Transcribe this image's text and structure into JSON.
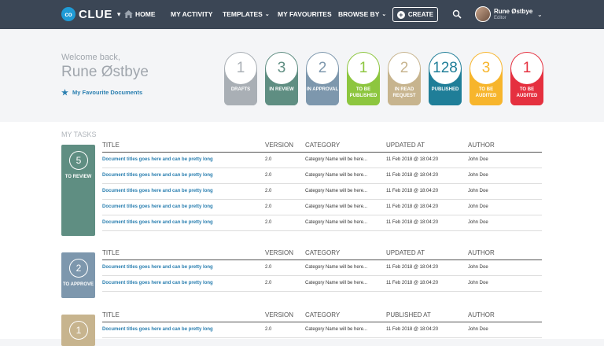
{
  "nav": {
    "logo_mark": "co",
    "logo_text": "CLUE",
    "items": [
      {
        "label": "HOME"
      },
      {
        "label": "MY ACTIVITY"
      },
      {
        "label": "TEMPLATES"
      },
      {
        "label": "MY FAVOURITES"
      },
      {
        "label": "BROWSE BY"
      }
    ],
    "create_label": "CREATE",
    "user": {
      "name": "Rune Østbye",
      "role": "Editor"
    }
  },
  "hero": {
    "welcome": "Welcome back,",
    "username": "Rune Østbye",
    "favourites_link": "My Favourite Documents",
    "stats": [
      {
        "count": "1",
        "label": "DRAFTS",
        "color": "#a9afb5"
      },
      {
        "count": "3",
        "label": "IN REVIEW",
        "color": "#5f8e82"
      },
      {
        "count": "2",
        "label": "IN APPROVAL",
        "color": "#7d97ad"
      },
      {
        "count": "1",
        "label": "TO BE PUBLISHED",
        "color": "#8dc63f"
      },
      {
        "count": "2",
        "label": "IN READ REQUEST",
        "color": "#c7b48e"
      },
      {
        "count": "128",
        "label": "PUBLISHED",
        "color": "#1f7e98"
      },
      {
        "count": "3",
        "label": "TO BE AUDITED",
        "color": "#f7b52c"
      },
      {
        "count": "1",
        "label": "TO BE AUDITED",
        "color": "#e5303f"
      }
    ]
  },
  "tasks": {
    "title": "MY TASKS",
    "groups": [
      {
        "count": "5",
        "label": "TO REVIEW",
        "color": "#5f8e82",
        "headers": [
          "TITLE",
          "VERSION",
          "CATEGORY",
          "UPDATED AT",
          "AUTHOR"
        ],
        "rows": [
          [
            "Document titles goes here and can be pretty long",
            "2.0",
            "Category Name will be here...",
            "11 Feb 2018 @ 18:04:20",
            "John Doe"
          ],
          [
            "Document titles goes here and can be pretty long",
            "2.0",
            "Category Name will be here...",
            "11 Feb 2018 @ 18:04:20",
            "John Doe"
          ],
          [
            "Document titles goes here and can be pretty long",
            "2.0",
            "Category Name will be here...",
            "11 Feb 2018 @ 18:04:20",
            "John Doe"
          ],
          [
            "Document titles goes here and can be pretty long",
            "2.0",
            "Category Name will be here...",
            "11 Feb 2018 @ 18:04:20",
            "John Doe"
          ],
          [
            "Document titles goes here and can be pretty long",
            "2.0",
            "Category Name will be here...",
            "11 Feb 2018 @ 18:04:20",
            "John Doe"
          ]
        ]
      },
      {
        "count": "2",
        "label": "TO APPROVE",
        "color": "#7d97ad",
        "headers": [
          "TITLE",
          "VERSION",
          "CATEGORY",
          "UPDATED AT",
          "AUTHOR"
        ],
        "rows": [
          [
            "Document titles goes here and can be pretty long",
            "2.0",
            "Category Name will be here...",
            "11 Feb 2018 @ 18:04:20",
            "John Doe"
          ],
          [
            "Document titles goes here and can be pretty long",
            "2.0",
            "Category Name will be here...",
            "11 Feb 2018 @ 18:04:20",
            "John Doe"
          ]
        ]
      },
      {
        "count": "1",
        "label": "",
        "color": "#c7b48e",
        "headers": [
          "TITLE",
          "VERSION",
          "CATEGORY",
          "PUBLISHED AT",
          "AUTHOR"
        ],
        "rows": [
          [
            "Document titles goes here and can be pretty long",
            "2.0",
            "Category Name will be here...",
            "11 Feb 2018 @ 18:04:20",
            "John Doe"
          ]
        ]
      }
    ]
  }
}
